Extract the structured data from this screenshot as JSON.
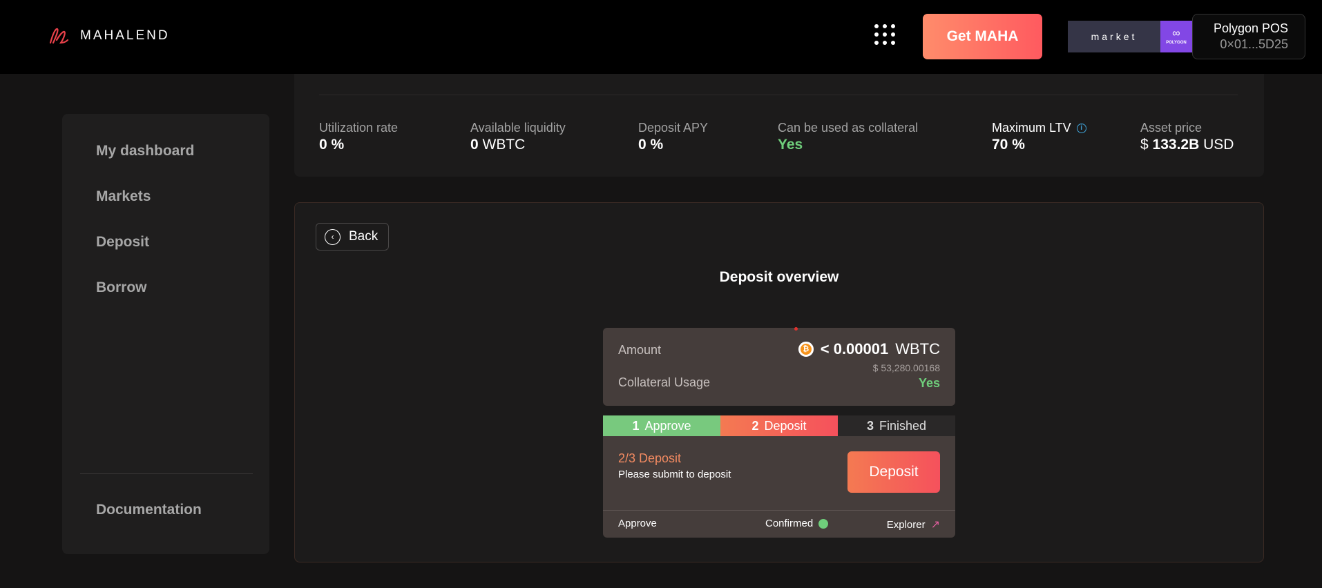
{
  "header": {
    "brand": "MAHALEND",
    "get_maha_label": "Get MAHA",
    "market_label": "market",
    "network_badge": "POLYGON",
    "network_name": "Polygon POS",
    "wallet_address": "0×01...5D25",
    "accent_color": "#ff5a5f"
  },
  "sidebar": {
    "items": [
      {
        "label": "My dashboard"
      },
      {
        "label": "Markets"
      },
      {
        "label": "Deposit"
      },
      {
        "label": "Borrow"
      }
    ],
    "footer_item": "Documentation"
  },
  "stats": {
    "utilization": {
      "label": "Utilization rate",
      "value": "0",
      "unit": "%"
    },
    "liquidity": {
      "label": "Available liquidity",
      "value": "0",
      "unit": "WBTC"
    },
    "apy": {
      "label": "Deposit APY",
      "value": "0",
      "unit": "%"
    },
    "collateral": {
      "label": "Can be used as collateral",
      "value": "Yes"
    },
    "ltv": {
      "label": "Maximum LTV",
      "value": "70",
      "unit": "%"
    },
    "price": {
      "label": "Asset price",
      "prefix": "$",
      "value": "133.2B",
      "unit": "USD"
    }
  },
  "deposit_panel": {
    "back_label": "Back",
    "title": "Deposit overview",
    "amount_label": "Amount",
    "amount_value": "< 0.00001",
    "amount_asset": "WBTC",
    "amount_usd": "$ 53,280.00168",
    "collateral_label": "Collateral Usage",
    "collateral_value": "Yes",
    "steps": [
      {
        "num": "1",
        "label": "Approve"
      },
      {
        "num": "2",
        "label": "Deposit"
      },
      {
        "num": "3",
        "label": "Finished"
      }
    ],
    "action_title": "2/3 Deposit",
    "action_subtitle": "Please submit to deposit",
    "deposit_button": "Deposit",
    "footer_approve": "Approve",
    "footer_confirmed": "Confirmed",
    "footer_explorer": "Explorer"
  }
}
